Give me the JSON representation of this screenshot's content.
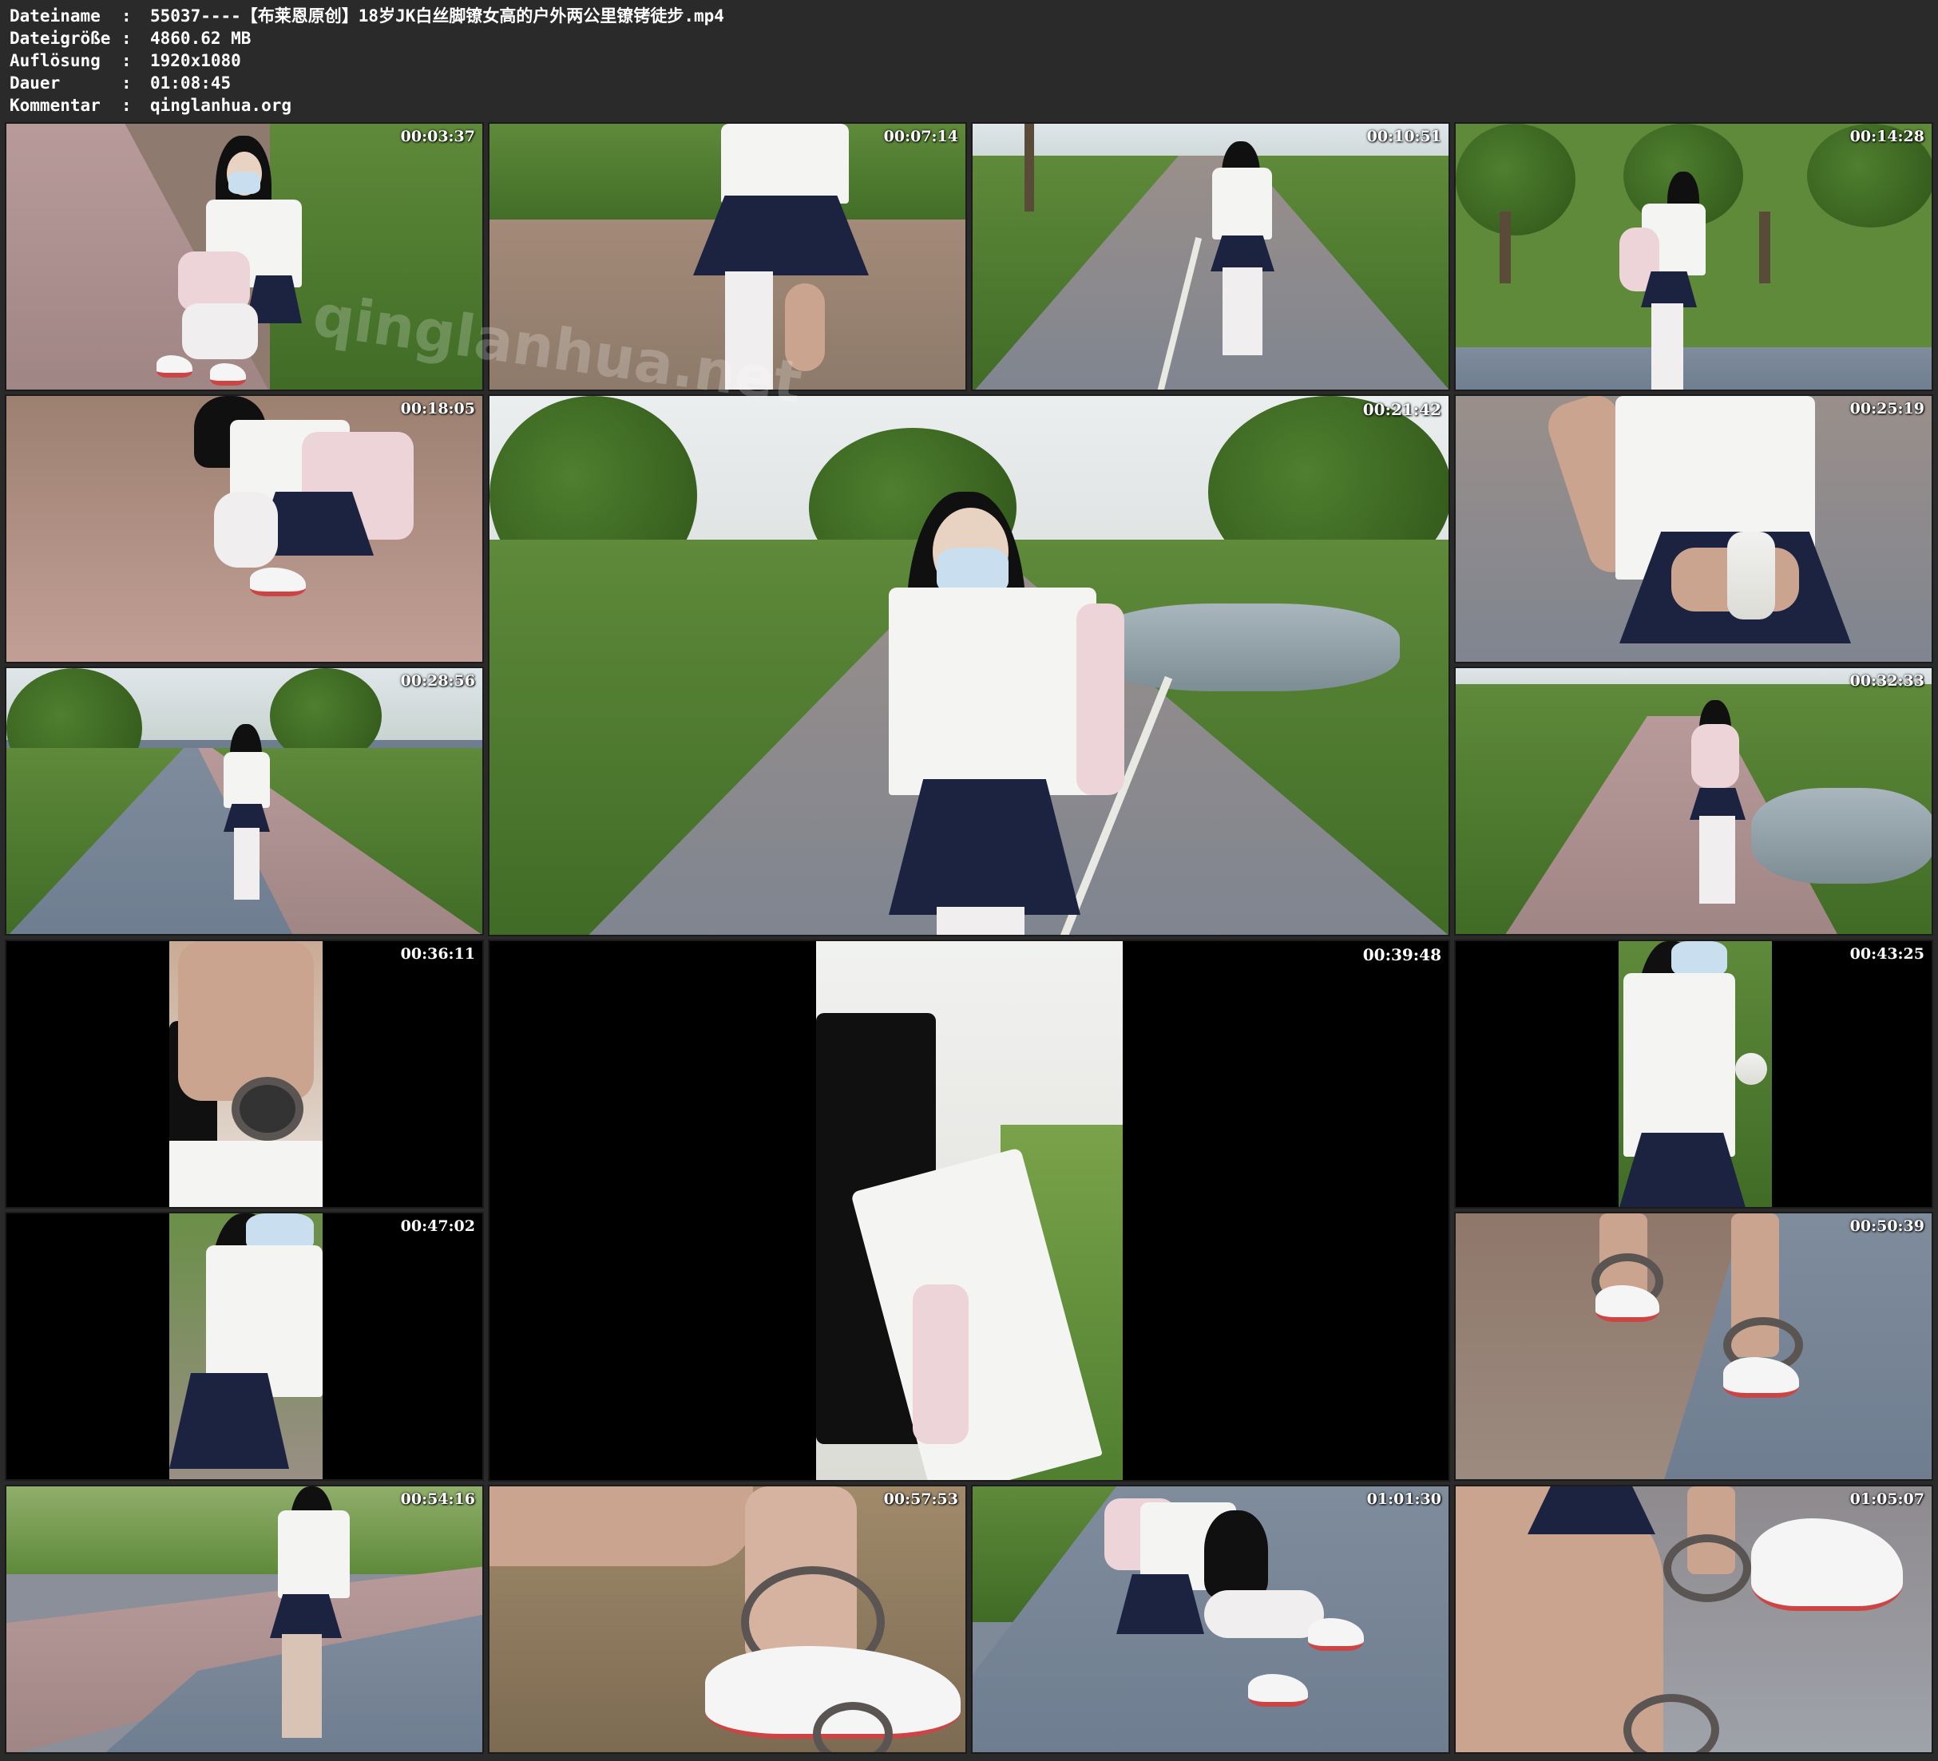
{
  "header": {
    "rows": [
      {
        "label": "Dateiname",
        "value": "55037----【布莱恩原创】18岁JK白丝脚镣女高的户外两公里镣铐徒步.mp4"
      },
      {
        "label": "Dateigröße",
        "value": "4860.62 MB"
      },
      {
        "label": "Auflösung",
        "value": "1920x1080"
      },
      {
        "label": "Dauer",
        "value": "01:08:45"
      },
      {
        "label": "Kommentar",
        "value": "qinglanhua.org"
      }
    ],
    "separator": ":"
  },
  "thumbnails": [
    {
      "timestamp": "00:03:37"
    },
    {
      "timestamp": "00:07:14"
    },
    {
      "timestamp": "00:10:51"
    },
    {
      "timestamp": "00:14:28"
    },
    {
      "timestamp": "00:18:05"
    },
    {
      "timestamp": "00:21:42"
    },
    {
      "timestamp": "00:25:19"
    },
    {
      "timestamp": "00:28:56"
    },
    {
      "timestamp": "00:32:33"
    },
    {
      "timestamp": "00:36:11"
    },
    {
      "timestamp": "00:39:48"
    },
    {
      "timestamp": "00:43:25"
    },
    {
      "timestamp": "00:47:02"
    },
    {
      "timestamp": "00:50:39"
    },
    {
      "timestamp": "00:54:16"
    },
    {
      "timestamp": "00:57:53"
    },
    {
      "timestamp": "01:01:30"
    },
    {
      "timestamp": "01:05:07"
    }
  ],
  "watermark": "qinglanhua.net",
  "colors": {
    "background": "#2a2a2a",
    "text": "#ffffff"
  }
}
